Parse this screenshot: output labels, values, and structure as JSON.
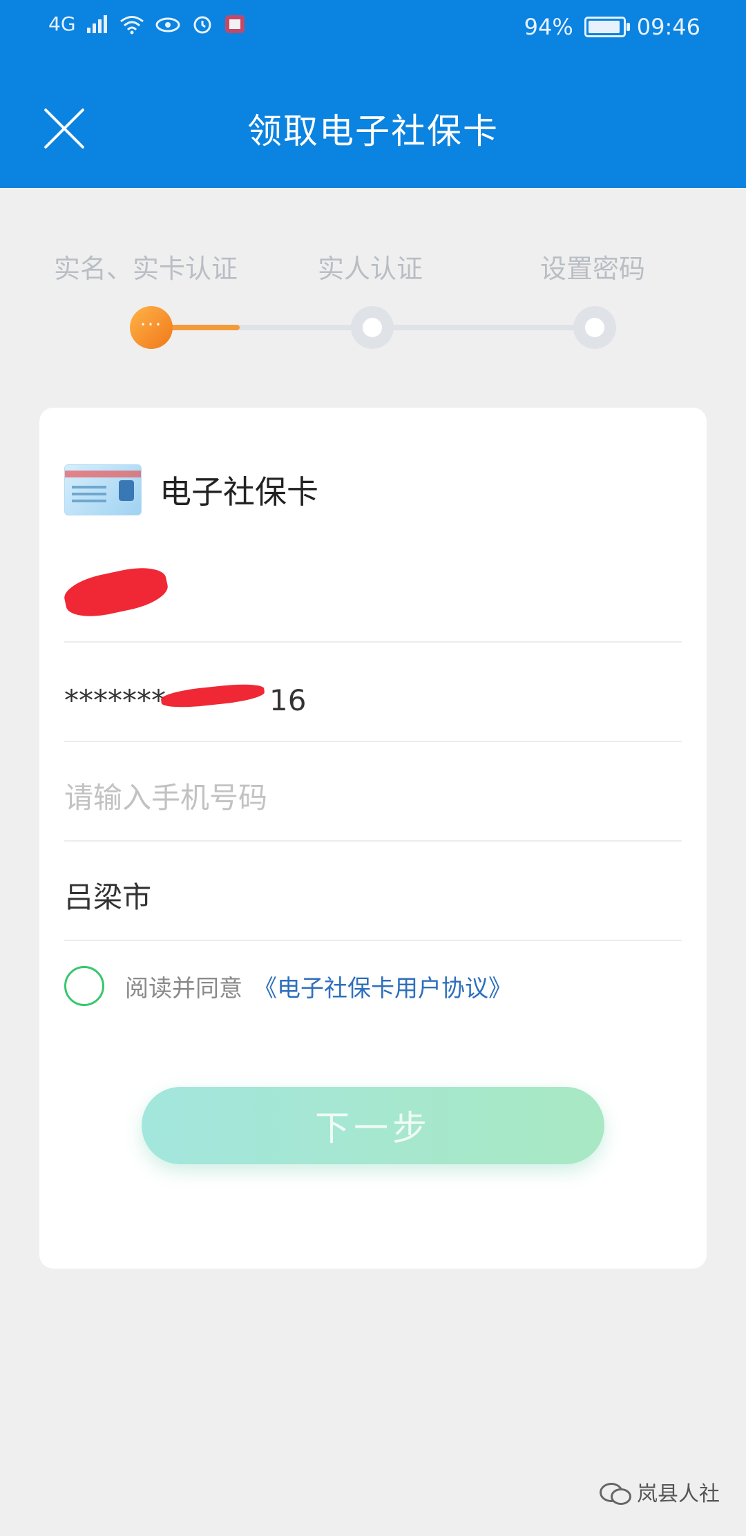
{
  "status_bar": {
    "network": "4G",
    "battery_text": "94%",
    "battery_level": 0.94,
    "time": "09:46"
  },
  "header": {
    "title": "领取电子社保卡"
  },
  "steps": {
    "labels": [
      "实名、实卡认证",
      "实人认证",
      "设置密码"
    ],
    "active_index": 0,
    "active_dot_text": "···",
    "progress": 0.2
  },
  "card": {
    "title": "电子社保卡",
    "name_value": "",
    "id_value": "*******",
    "id_tail": "16",
    "phone_placeholder": "请输入手机号码",
    "city_value": "吕梁市",
    "agree_text": "阅读并同意",
    "agree_link": "《电子社保卡用户协议》",
    "next_button": "下一步"
  },
  "watermark": {
    "text": "岚县人社"
  }
}
